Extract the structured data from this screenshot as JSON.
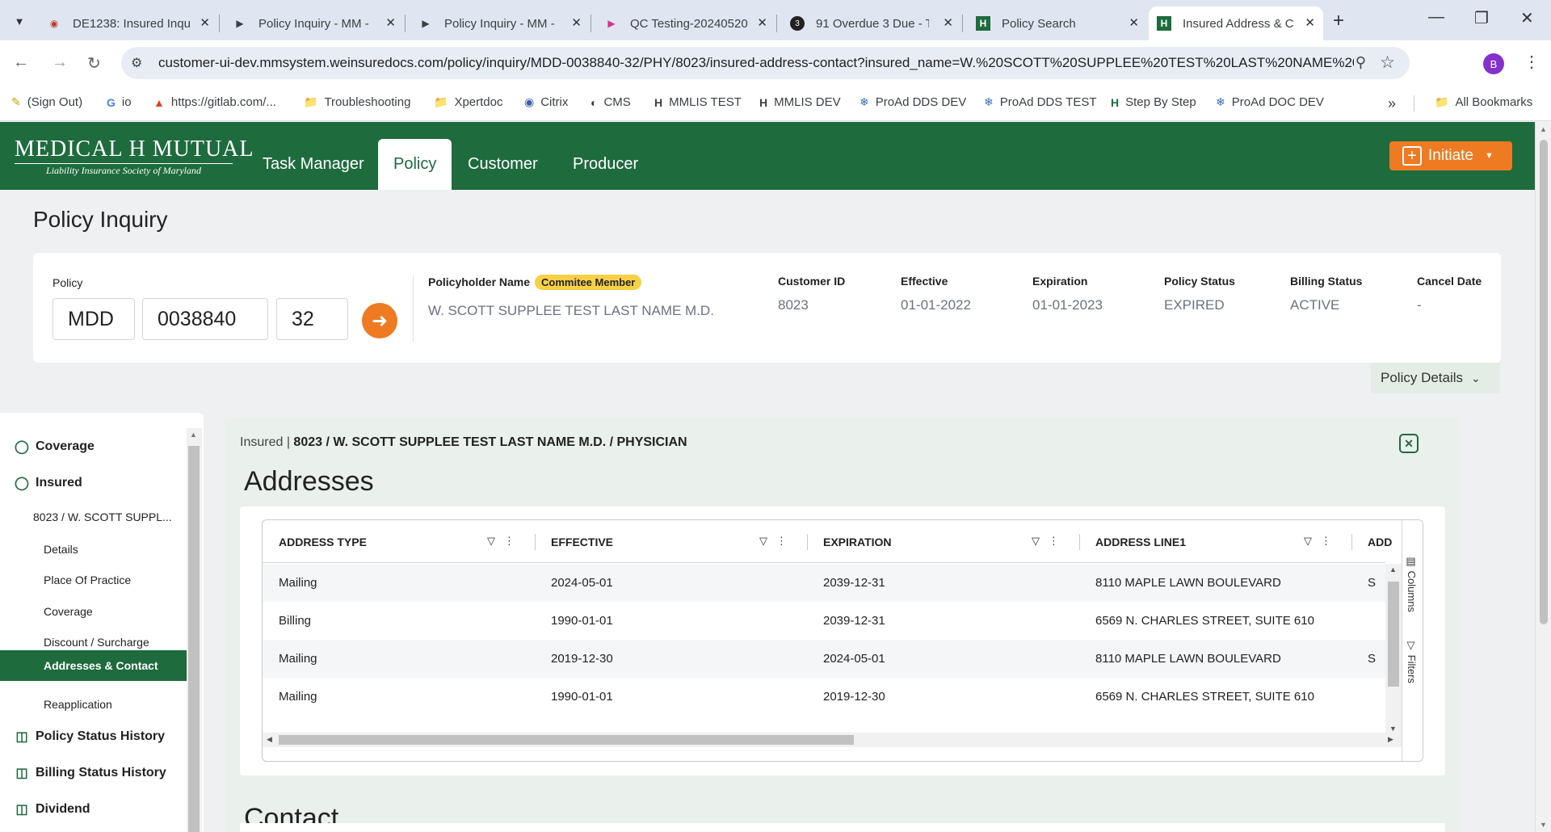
{
  "browser": {
    "tabs": [
      {
        "title": "DE1238: Insured Inqu",
        "icon": "azure-devops-icon",
        "active": false
      },
      {
        "title": "Policy Inquiry - MM -",
        "icon": "play-icon",
        "active": false
      },
      {
        "title": "Policy Inquiry - MM -",
        "icon": "play-icon",
        "active": false
      },
      {
        "title": "QC Testing-20240520",
        "icon": "clickup-icon",
        "active": false
      },
      {
        "title": "91 Overdue 3 Due - T",
        "icon": "task-app-icon",
        "active": false
      },
      {
        "title": "Policy Search",
        "icon": "mm-logo-icon",
        "active": false
      },
      {
        "title": "Insured Address & C",
        "icon": "mm-logo-icon",
        "active": true
      }
    ],
    "url": "customer-ui-dev.mmsystem.weinsuredocs.com/policy/inquiry/MDD-0038840-32/PHY/8023/insured-address-contact?insured_name=W.%20SCOTT%20SUPPLEE%20TEST%20LAST%20NAME%20M.D...",
    "profile_initial": "B",
    "bookmarks": [
      {
        "label": "(Sign Out)",
        "icon": "pen-icon"
      },
      {
        "label": "io",
        "icon": "google-icon"
      },
      {
        "label": "https://gitlab.com/...",
        "icon": "gitlab-icon"
      },
      {
        "label": "Troubleshooting",
        "icon": "folder-icon"
      },
      {
        "label": "Xpertdoc",
        "icon": "folder-icon"
      },
      {
        "label": "Citrix",
        "icon": "citrix-icon"
      },
      {
        "label": "CMS",
        "icon": "globe-icon"
      },
      {
        "label": "MMLIS TEST",
        "icon": "mm-logo-icon"
      },
      {
        "label": "MMLIS DEV",
        "icon": "mm-logo-icon"
      },
      {
        "label": "ProAd DDS DEV",
        "icon": "proad-icon"
      },
      {
        "label": "ProAd DDS TEST",
        "icon": "proad-icon"
      },
      {
        "label": "Step By Step",
        "icon": "mm-green-icon"
      },
      {
        "label": "ProAd DOC DEV",
        "icon": "proad-icon"
      }
    ],
    "all_bookmarks": "All Bookmarks"
  },
  "app": {
    "logo_line1": "MEDICAL H MUTUAL",
    "logo_line2": "Liability Insurance Society of Maryland",
    "nav": [
      "Task Manager",
      "Policy",
      "Customer",
      "Producer"
    ],
    "active_nav": "Policy",
    "initiate_label": "Initiate",
    "colors": {
      "brand_green": "#1e6b3e",
      "accent_orange": "#ee7a22",
      "badge_yellow": "#f7d046"
    }
  },
  "page_title": "Policy Inquiry",
  "policy": {
    "label": "Policy",
    "prefix": "MDD",
    "number": "0038840",
    "suffix": "32",
    "fields": {
      "holder_label": "Policyholder Name",
      "holder_badge": "Commitee Member",
      "holder_value": "W. SCOTT SUPPLEE TEST LAST NAME M.D.",
      "customer_id_label": "Customer ID",
      "customer_id_value": "8023",
      "effective_label": "Effective",
      "effective_value": "01-01-2022",
      "expiration_label": "Expiration",
      "expiration_value": "01-01-2023",
      "policy_status_label": "Policy Status",
      "policy_status_value": "EXPIRED",
      "billing_status_label": "Billing Status",
      "billing_status_value": "ACTIVE",
      "cancel_date_label": "Cancel Date",
      "cancel_date_value": "-"
    },
    "details_toggle": "Policy Details"
  },
  "sidebar": {
    "items": [
      {
        "label": "Coverage",
        "icon": "shield-icon"
      },
      {
        "label": "Insured",
        "icon": "shield-icon"
      }
    ],
    "insured_group": "8023 / W. SCOTT SUPPL...",
    "sub_items": [
      "Details",
      "Place Of Practice",
      "Coverage",
      "Discount / Surcharge",
      "Addresses & Contact",
      "Reapplication"
    ],
    "active_sub": "Addresses & Contact",
    "bottom_items": [
      {
        "label": "Policy Status History",
        "icon": "clipboard-icon"
      },
      {
        "label": "Billing Status History",
        "icon": "clipboard-icon"
      },
      {
        "label": "Dividend",
        "icon": "clipboard-icon"
      }
    ]
  },
  "main": {
    "crumb_prefix": "Insured |",
    "crumb_bold": "8023 / W. SCOTT SUPPLEE TEST LAST NAME M.D. / PHYSICIAN",
    "addresses_title": "Addresses",
    "contact_title": "Contact",
    "grid": {
      "columns": [
        "ADDRESS TYPE",
        "EFFECTIVE",
        "EXPIRATION",
        "ADDRESS LINE1",
        "ADD"
      ],
      "rows": [
        [
          "Mailing",
          "2024-05-01",
          "2039-12-31",
          "8110 MAPLE LAWN BOULEVARD",
          "S"
        ],
        [
          "Billing",
          "1990-01-01",
          "2039-12-31",
          "6569 N. CHARLES STREET, SUITE 610",
          ""
        ],
        [
          "Mailing",
          "2019-12-30",
          "2024-05-01",
          "8110 MAPLE LAWN BOULEVARD",
          "S"
        ],
        [
          "Mailing",
          "1990-01-01",
          "2019-12-30",
          "6569 N. CHARLES STREET, SUITE 610",
          ""
        ]
      ],
      "side_panels": [
        "Columns",
        "Filters"
      ]
    }
  }
}
